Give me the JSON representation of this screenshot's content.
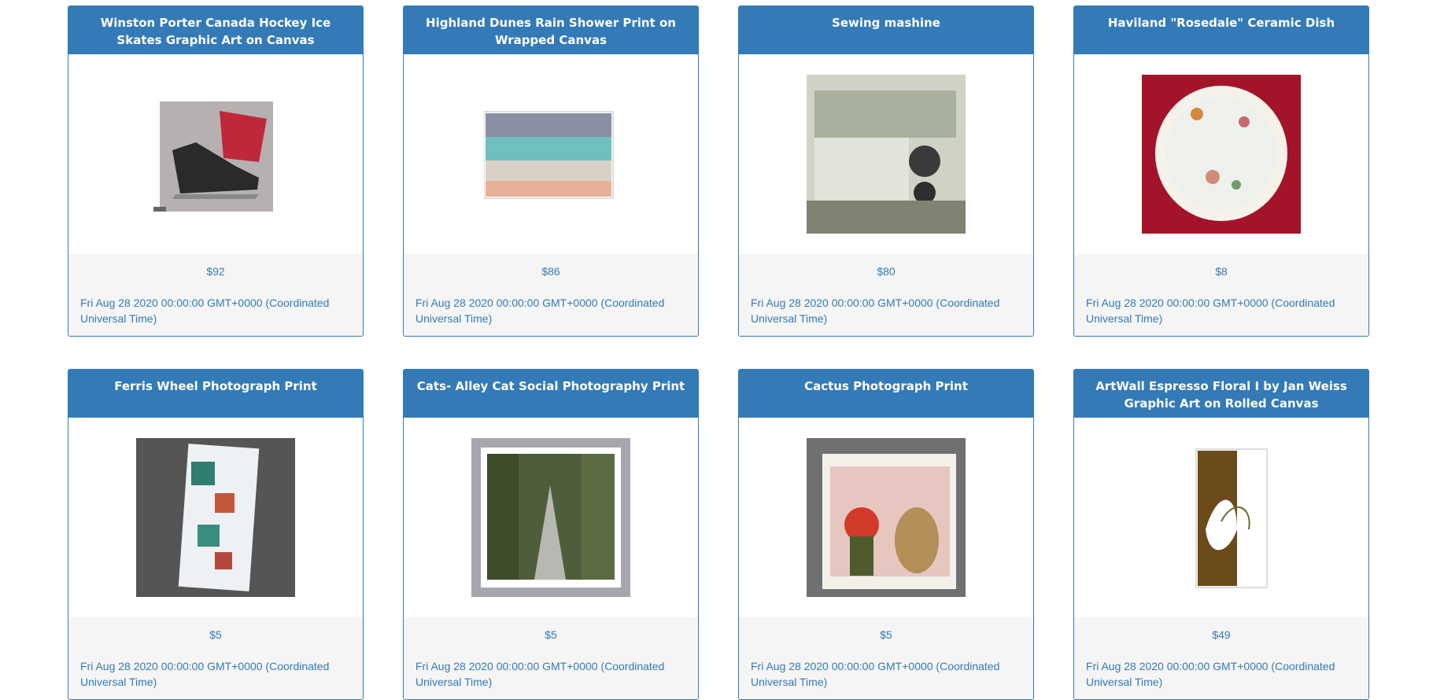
{
  "products": [
    {
      "title": "Winston Porter Canada Hockey Ice Skates Graphic Art on Canvas",
      "price": "$92",
      "date": "Fri Aug 28 2020 00:00:00 GMT+0000 (Coordinated Universal Time)",
      "image_icon": "hockey-skate-canvas-image"
    },
    {
      "title": "Highland Dunes Rain Shower Print on Wrapped Canvas",
      "price": "$86",
      "date": "Fri Aug 28 2020 00:00:00 GMT+0000 (Coordinated Universal Time)",
      "image_icon": "beach-canvas-image"
    },
    {
      "title": "Sewing mashine",
      "price": "$80",
      "date": "Fri Aug 28 2020 00:00:00 GMT+0000 (Coordinated Universal Time)",
      "image_icon": "sewing-machine-image"
    },
    {
      "title": "Haviland \"Rosedale\" Ceramic Dish",
      "price": "$8",
      "date": "Fri Aug 28 2020 00:00:00 GMT+0000 (Coordinated Universal Time)",
      "image_icon": "ceramic-dish-image"
    },
    {
      "title": "Ferris Wheel Photograph Print",
      "price": "$5",
      "date": "Fri Aug 28 2020 00:00:00 GMT+0000 (Coordinated Universal Time)",
      "image_icon": "ferris-wheel-print-image"
    },
    {
      "title": "Cats- Alley Cat Social Photography Print",
      "price": "$5",
      "date": "Fri Aug 28 2020 00:00:00 GMT+0000 (Coordinated Universal Time)",
      "image_icon": "alley-cat-print-image"
    },
    {
      "title": "Cactus Photograph Print",
      "price": "$5",
      "date": "Fri Aug 28 2020 00:00:00 GMT+0000 (Coordinated Universal Time)",
      "image_icon": "cactus-print-image"
    },
    {
      "title": "ArtWall Espresso Floral I by Jan Weiss Graphic Art on Rolled Canvas",
      "price": "$49",
      "date": "Fri Aug 28 2020 00:00:00 GMT+0000 (Coordinated Universal Time)",
      "image_icon": "espresso-floral-canvas-image"
    }
  ],
  "colors": {
    "header_bg": "#337ab7",
    "footer_bg": "#f5f5f5",
    "text_link": "#337ab7"
  }
}
